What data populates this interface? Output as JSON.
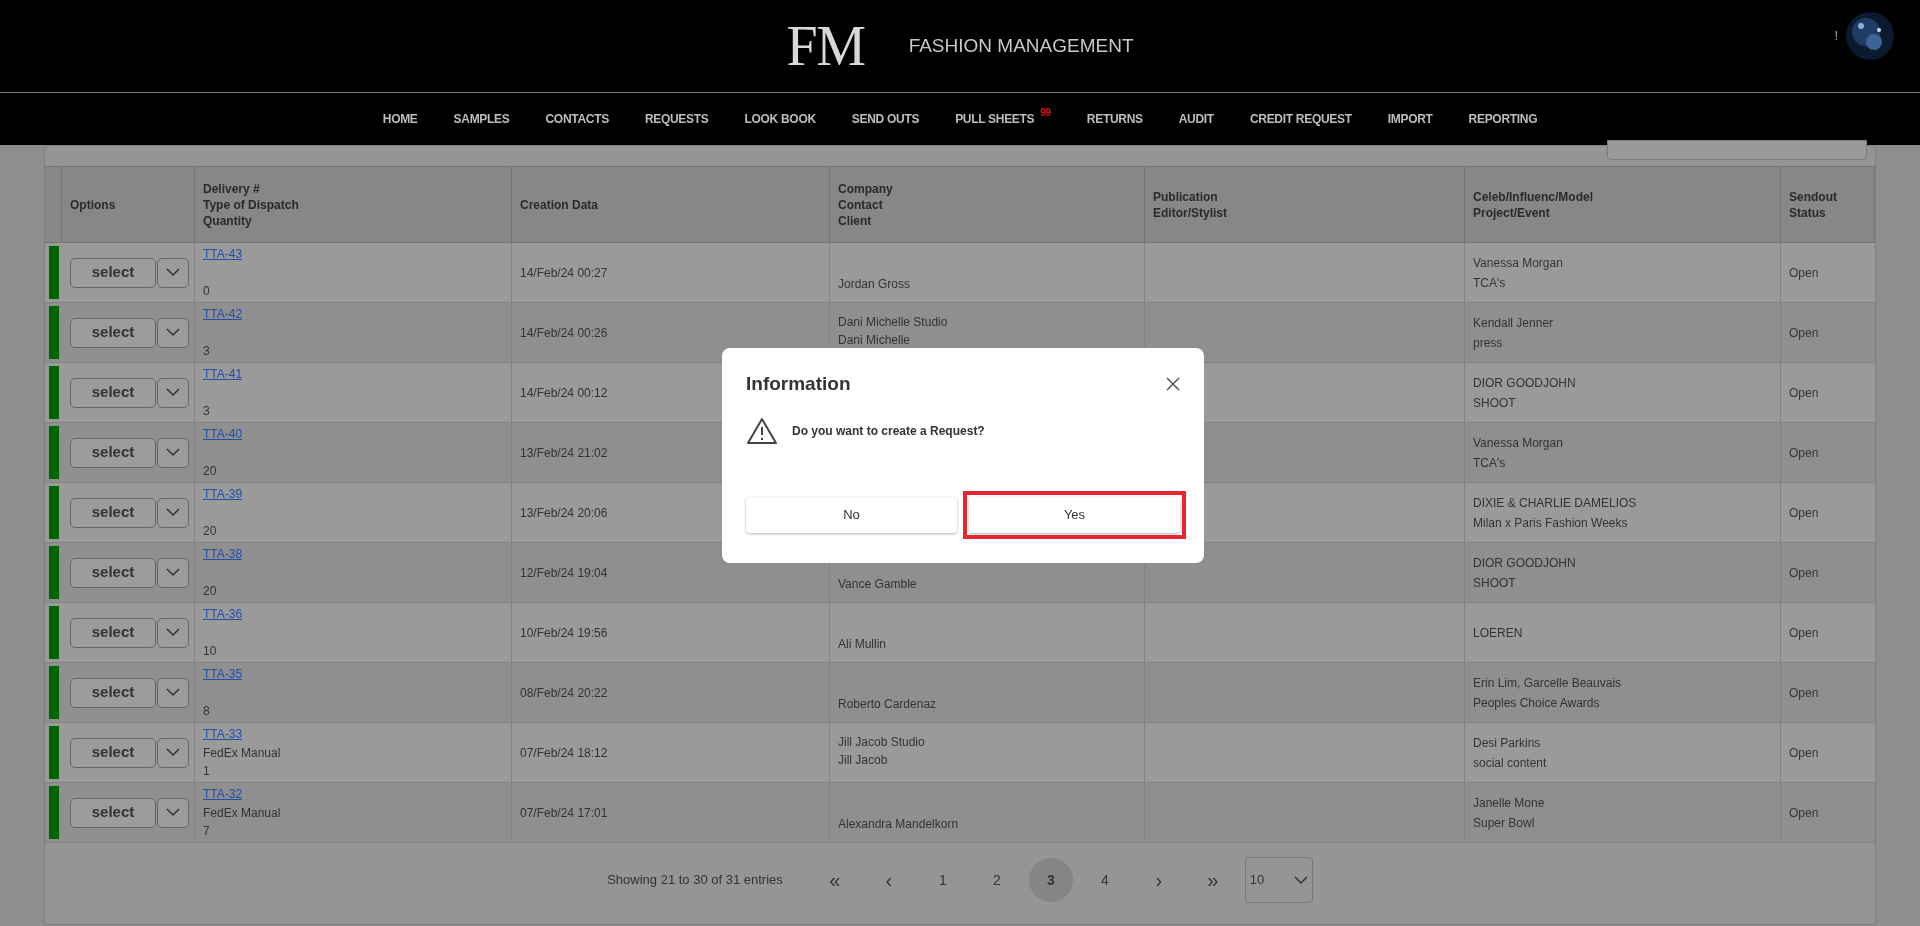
{
  "header": {
    "logo": "FM",
    "title": "FASHION MANAGEMENT",
    "alert": "!"
  },
  "nav": [
    {
      "label": "HOME"
    },
    {
      "label": "SAMPLES"
    },
    {
      "label": "CONTACTS"
    },
    {
      "label": "REQUESTS"
    },
    {
      "label": "LOOK BOOK"
    },
    {
      "label": "SEND OUTS"
    },
    {
      "label": "PULL SHEETS",
      "badge": "99"
    },
    {
      "label": "RETURNS"
    },
    {
      "label": "AUDIT"
    },
    {
      "label": "CREDIT REQUEST"
    },
    {
      "label": "IMPORT"
    },
    {
      "label": "REPORTING"
    }
  ],
  "table": {
    "columns": [
      [
        "Options"
      ],
      [
        "Delivery #",
        "Type of Dispatch",
        "Quantity"
      ],
      [
        "Creation Data"
      ],
      [
        "Company",
        "Contact",
        "Client"
      ],
      [
        "Publication",
        "Editor/Stylist"
      ],
      [
        "Celeb/Influenc/Model",
        "Project/Event"
      ],
      [
        "Sendout",
        "Status"
      ]
    ],
    "rows": [
      {
        "color": "#006400",
        "select": "select",
        "delivery": "TTA-43",
        "quantity": "0",
        "created": "14/Feb/24 00:27",
        "contact": "Jordan Gross",
        "celeb": "Vanessa Morgan",
        "project": "TCA's",
        "status": "Open"
      },
      {
        "color": "#006400",
        "select": "select",
        "delivery": "TTA-42",
        "quantity": "3",
        "created": "14/Feb/24 00:26",
        "company": "Dani Michelle Studio",
        "contact": "Dani Michelle",
        "celeb": "Kendall Jenner",
        "project": "press",
        "status": "Open"
      },
      {
        "color": "#006400",
        "select": "select",
        "delivery": "TTA-41",
        "quantity": "3",
        "created": "14/Feb/24 00:12",
        "celeb": "DIOR GOODJOHN",
        "project": "SHOOT",
        "status": "Open"
      },
      {
        "color": "#006400",
        "select": "select",
        "delivery": "TTA-40",
        "quantity": "20",
        "created": "13/Feb/24 21:02",
        "celeb": "Vanessa Morgan",
        "project": "TCA's",
        "status": "Open"
      },
      {
        "color": "#006400",
        "select": "select",
        "delivery": "TTA-39",
        "quantity": "20",
        "created": "13/Feb/24 20:06",
        "celeb": "DIXIE & CHARLIE DAMELIOS",
        "project": "Milan x Paris Fashion Weeks",
        "status": "Open"
      },
      {
        "color": "#006400",
        "select": "select",
        "delivery": "TTA-38",
        "quantity": "20",
        "created": "12/Feb/24 19:04",
        "contact": "Vance Gamble",
        "celeb": "DIOR GOODJOHN",
        "project": "SHOOT",
        "status": "Open"
      },
      {
        "color": "#006400",
        "select": "select",
        "delivery": "TTA-36",
        "quantity": "10",
        "created": "10/Feb/24 19:56",
        "contact": "Ali Mullin",
        "celeb": "LOEREN",
        "status": "Open"
      },
      {
        "color": "#006400",
        "select": "select",
        "delivery": "TTA-35",
        "quantity": "8",
        "created": "08/Feb/24 20:22",
        "contact": "Roberto Cardenaz",
        "celeb": "Erin Lim, Garcelle Beauvais",
        "project": "Peoples Choice Awards",
        "status": "Open"
      },
      {
        "color": "#006400",
        "select": "select",
        "delivery": "TTA-33",
        "dispatch": "FedEx Manual",
        "quantity": "1",
        "created": "07/Feb/24 18:12",
        "company": "Jill Jacob Studio",
        "contact": "Jill Jacob",
        "celeb": "Desi Parkins",
        "project": "social content",
        "status": "Open"
      },
      {
        "color": "#006400",
        "select": "select",
        "delivery": "TTA-32",
        "dispatch": "FedEx Manual",
        "quantity": "7",
        "created": "07/Feb/24 17:01",
        "contact": "Alexandra Mandelkorn",
        "celeb": "Janelle Mone",
        "project": "Super Bowl",
        "status": "Open"
      }
    ]
  },
  "pagination": {
    "summary": "Showing 21 to 30 of 31 entries",
    "first": "«",
    "prev": "‹",
    "pages": [
      {
        "label": "1",
        "selected": false
      },
      {
        "label": "2",
        "selected": false
      },
      {
        "label": "3",
        "selected": true
      },
      {
        "label": "4",
        "selected": false
      }
    ],
    "next": "›",
    "last": "»",
    "page_size": "10"
  },
  "dialog": {
    "title": "Information",
    "message": "Do you want to create a Request?",
    "buttons": [
      {
        "label": "No",
        "highlighted": false
      },
      {
        "label": "Yes",
        "highlighted": true
      }
    ]
  }
}
